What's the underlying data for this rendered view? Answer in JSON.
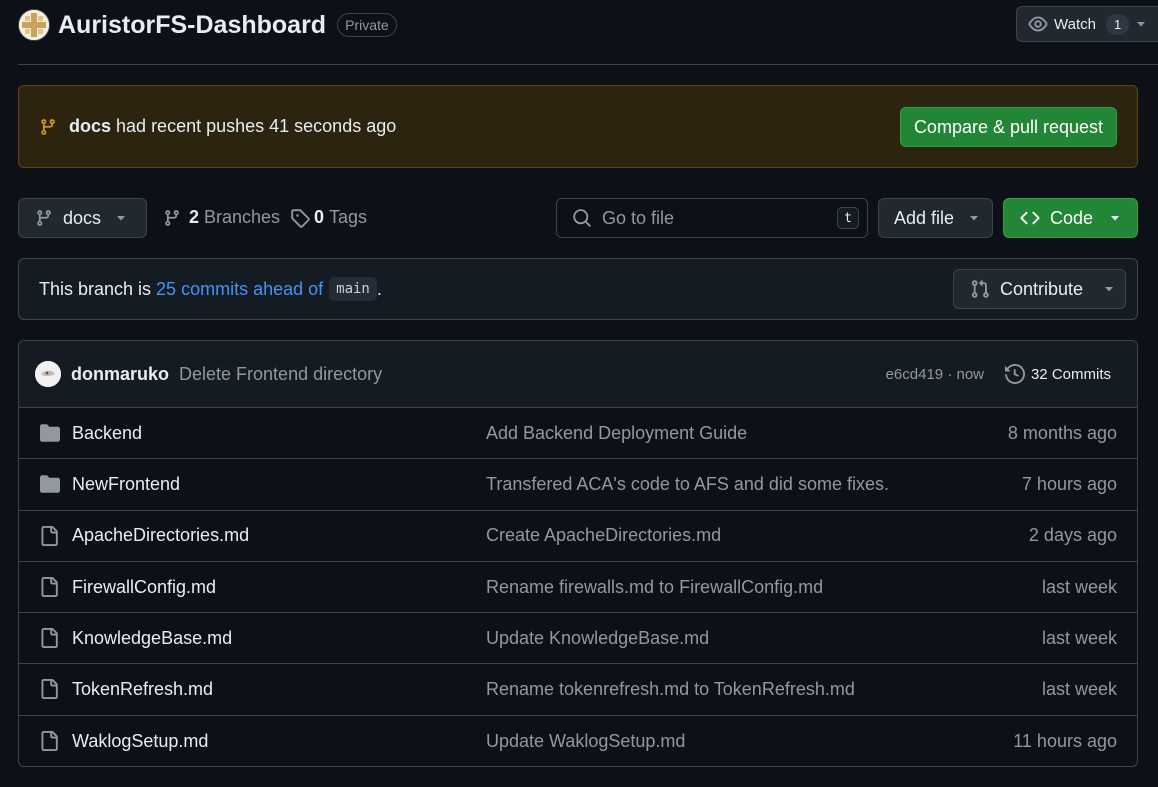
{
  "repo": {
    "name": "AuristorFS-Dashboard",
    "visibility": "Private",
    "watch_label": "Watch",
    "watch_count": "1"
  },
  "banner": {
    "branch": "docs",
    "message": "had recent pushes 41 seconds ago",
    "button": "Compare & pull request"
  },
  "toolbar": {
    "branch": "docs",
    "branches_count": "2",
    "branches_label": "Branches",
    "tags_count": "0",
    "tags_label": "Tags",
    "search_placeholder": "Go to file",
    "search_shortcut": "t",
    "add_file": "Add file",
    "code": "Code"
  },
  "branch_status": {
    "prefix": "This branch is",
    "link": "25 commits ahead of",
    "base": "main",
    "suffix": ".",
    "contribute": "Contribute"
  },
  "latest_commit": {
    "author": "donmaruko",
    "message": "Delete Frontend directory",
    "meta": "e6cd419 · now",
    "commits": "32 Commits"
  },
  "files": [
    {
      "type": "folder",
      "name": "Backend",
      "message": "Add Backend Deployment Guide",
      "date": "8 months ago"
    },
    {
      "type": "folder",
      "name": "NewFrontend",
      "message": "Transfered ACA's code to AFS and did some fixes.",
      "date": "7 hours ago"
    },
    {
      "type": "file",
      "name": "ApacheDirectories.md",
      "message": "Create ApacheDirectories.md",
      "date": "2 days ago"
    },
    {
      "type": "file",
      "name": "FirewallConfig.md",
      "message": "Rename firewalls.md to FirewallConfig.md",
      "date": "last week"
    },
    {
      "type": "file",
      "name": "KnowledgeBase.md",
      "message": "Update KnowledgeBase.md",
      "date": "last week"
    },
    {
      "type": "file",
      "name": "TokenRefresh.md",
      "message": "Rename tokenrefresh.md to TokenRefresh.md",
      "date": "last week"
    },
    {
      "type": "file",
      "name": "WaklogSetup.md",
      "message": "Update WaklogSetup.md",
      "date": "11 hours ago"
    }
  ]
}
